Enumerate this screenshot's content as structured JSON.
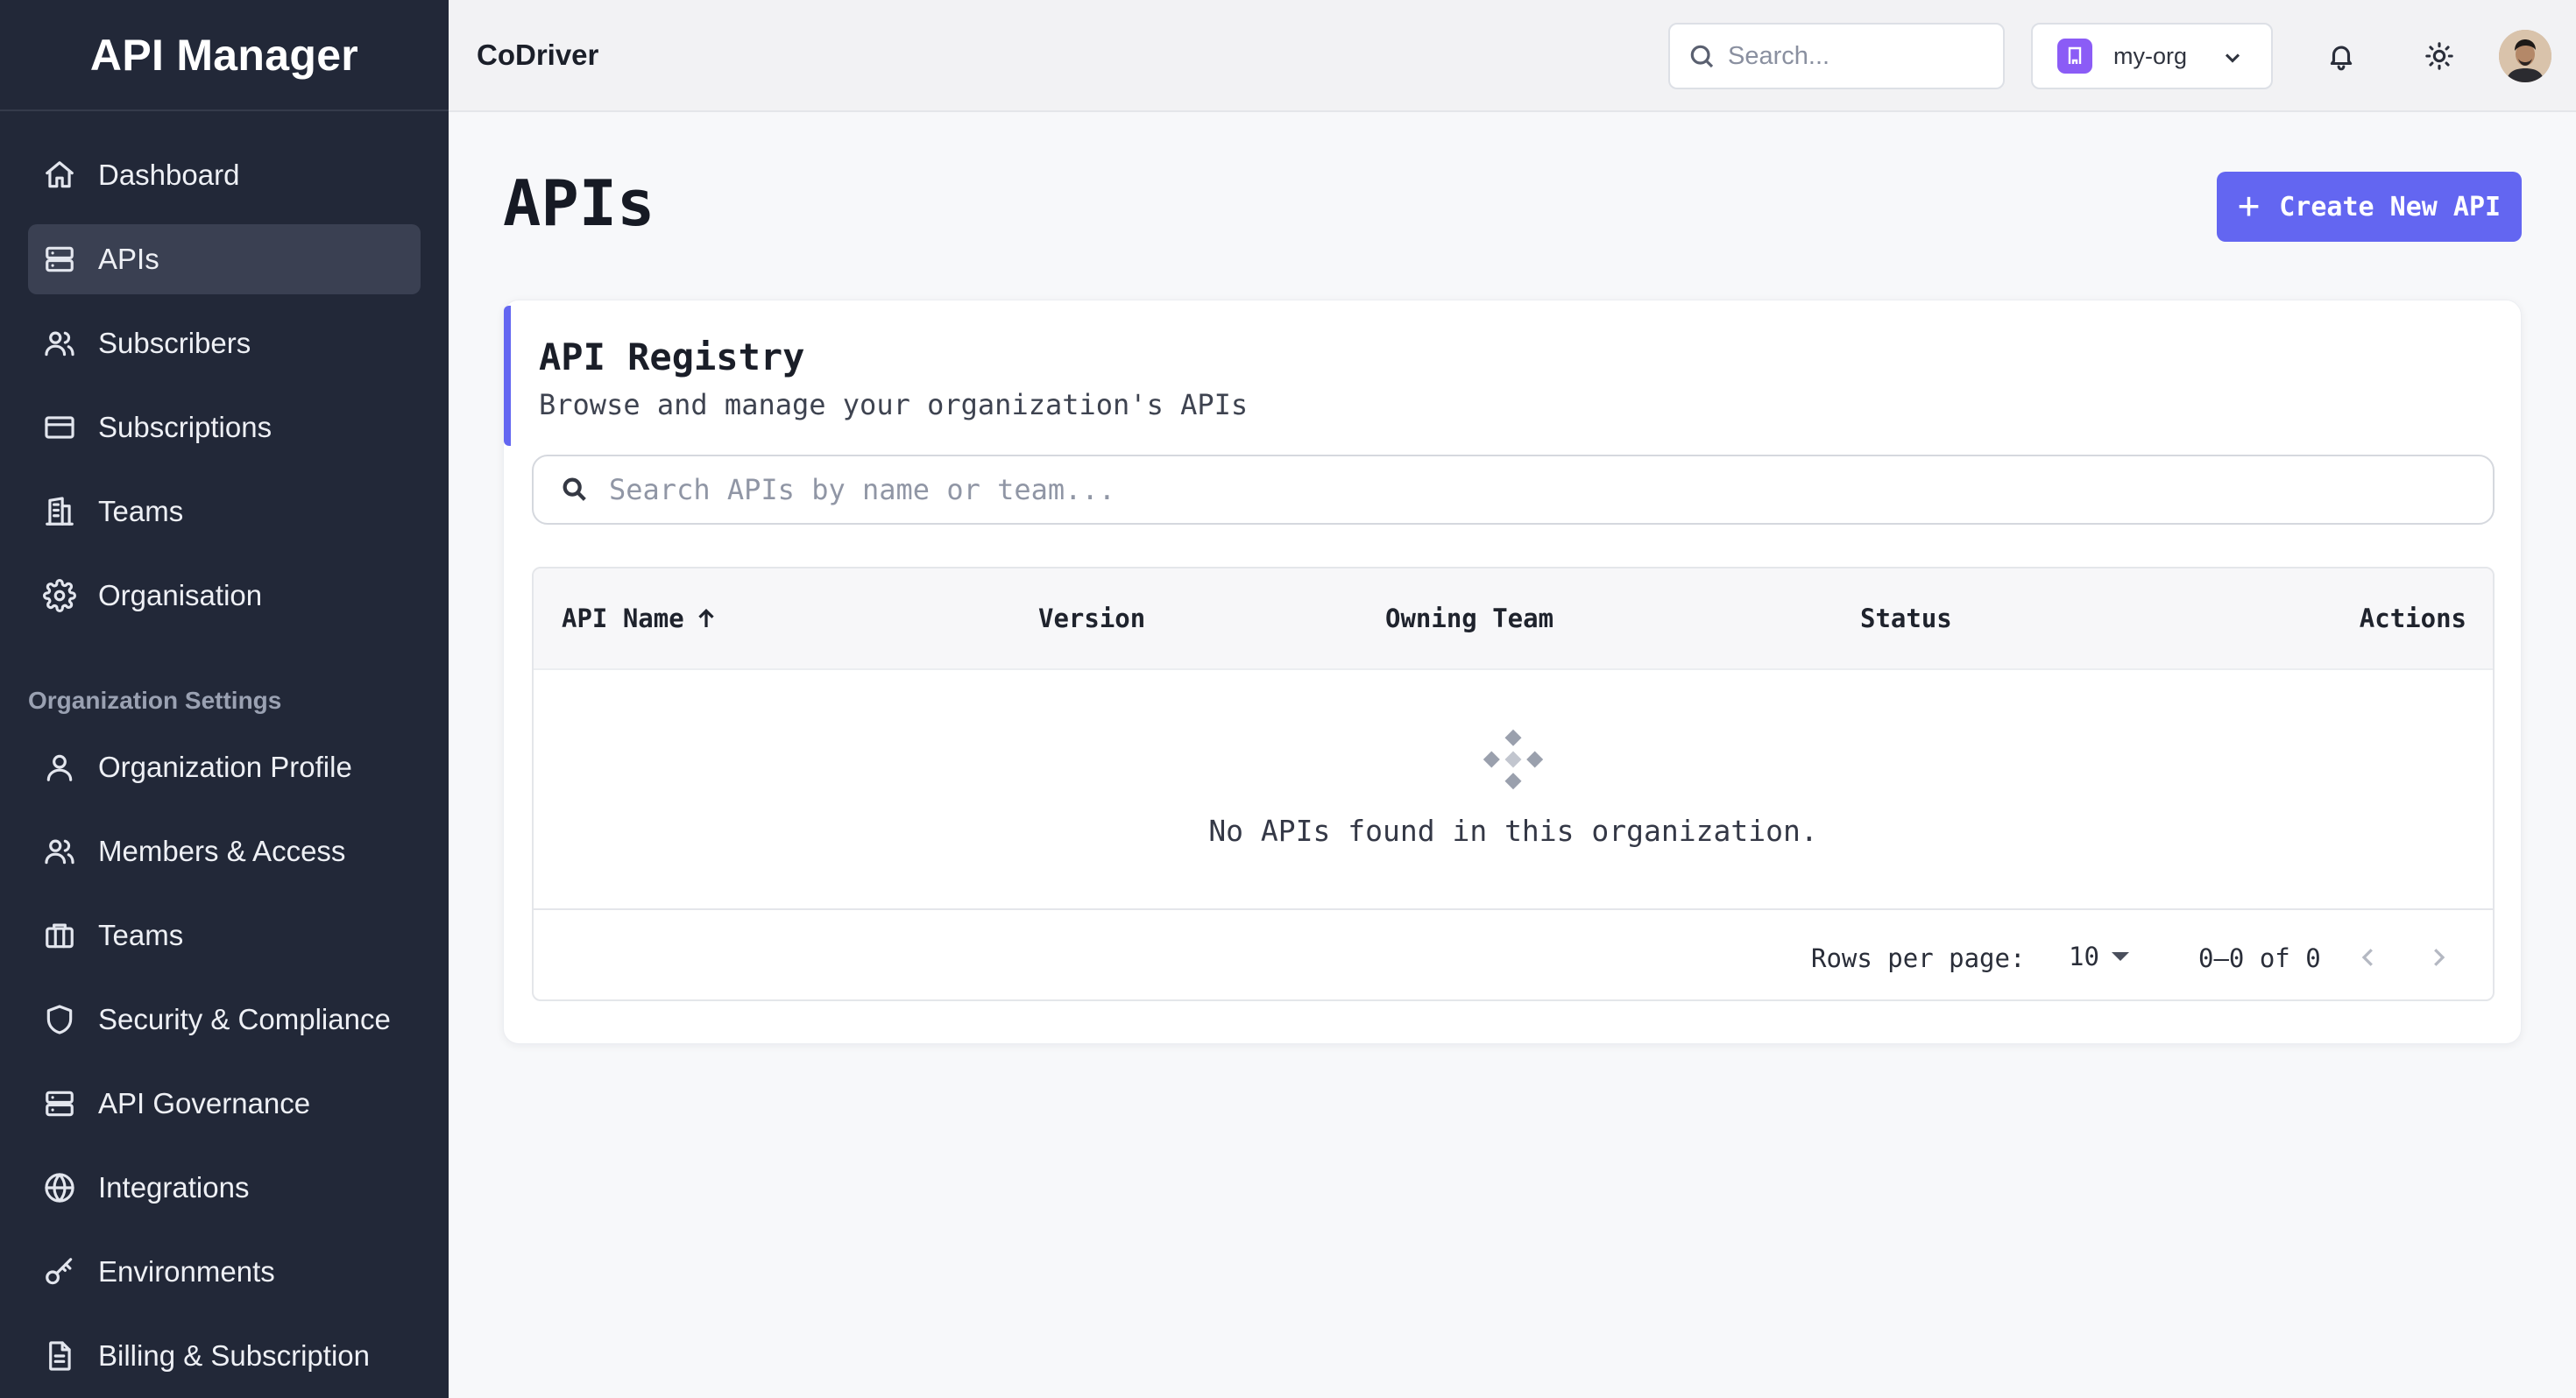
{
  "sidebar": {
    "brand": "API Manager",
    "main_items": [
      {
        "label": "Dashboard",
        "icon": "home-icon",
        "active": false
      },
      {
        "label": "APIs",
        "icon": "server-icon",
        "active": true
      },
      {
        "label": "Subscribers",
        "icon": "users-icon",
        "active": false
      },
      {
        "label": "Subscriptions",
        "icon": "credit-card-icon",
        "active": false
      },
      {
        "label": "Teams",
        "icon": "building-icon",
        "active": false
      },
      {
        "label": "Organisation",
        "icon": "gear-icon",
        "active": false
      }
    ],
    "section_title": "Organization Settings",
    "settings_items": [
      {
        "label": "Organization Profile",
        "icon": "user-icon"
      },
      {
        "label": "Members & Access",
        "icon": "users-icon"
      },
      {
        "label": "Teams",
        "icon": "briefcase-icon"
      },
      {
        "label": "Security & Compliance",
        "icon": "shield-icon"
      },
      {
        "label": "API Governance",
        "icon": "server-icon"
      },
      {
        "label": "Integrations",
        "icon": "globe-icon"
      },
      {
        "label": "Environments",
        "icon": "key-icon"
      },
      {
        "label": "Billing & Subscription",
        "icon": "document-icon"
      }
    ]
  },
  "header": {
    "title": "CoDriver",
    "search_placeholder": "Search...",
    "org_name": "my-org"
  },
  "main": {
    "page_title": "APIs",
    "create_button": "Create New API",
    "registry": {
      "title": "API Registry",
      "subtitle": "Browse and manage your organization's APIs",
      "search_placeholder": "Search APIs by name or team...",
      "columns": [
        "API Name",
        "Version",
        "Owning Team",
        "Status",
        "Actions"
      ],
      "empty_message": "No APIs found in this organization.",
      "rows_per_page_label": "Rows per page:",
      "rows_per_page": "10",
      "range": "0–0 of 0"
    }
  },
  "colors": {
    "sidebar_bg": "#222838",
    "accent": "#6366f1",
    "org_badge": "#8b5cf6"
  }
}
